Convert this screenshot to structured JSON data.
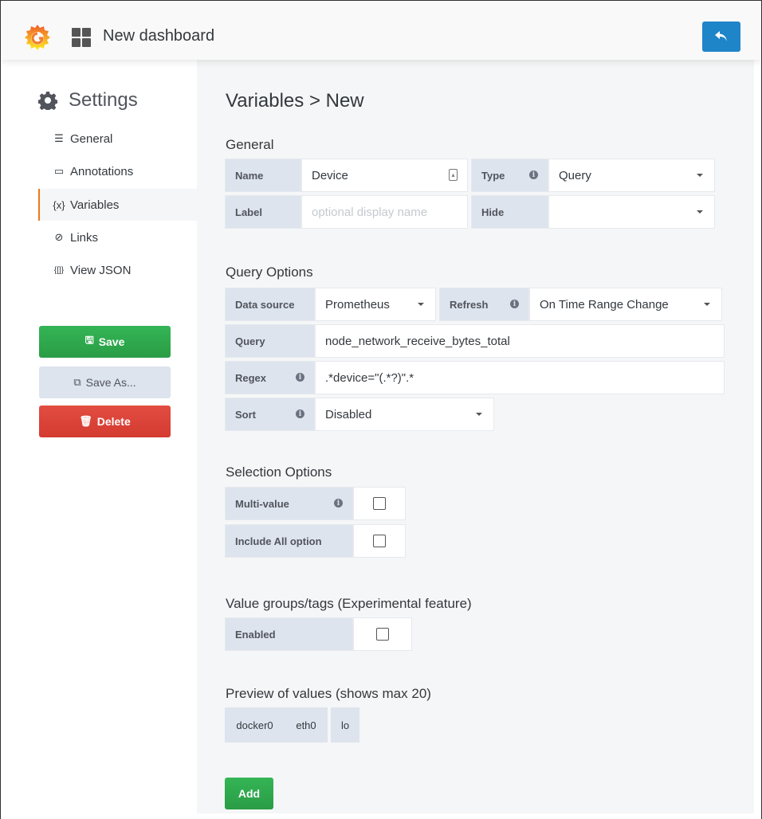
{
  "header": {
    "dashboard_title": "New dashboard"
  },
  "sidebar": {
    "title": "Settings",
    "items": [
      {
        "label": "General",
        "icon": "sliders-icon",
        "glyph": "☰"
      },
      {
        "label": "Annotations",
        "icon": "comment-icon",
        "glyph": "▭"
      },
      {
        "label": "Variables",
        "icon": "variable-icon",
        "glyph": "{x}"
      },
      {
        "label": "Links",
        "icon": "link-icon",
        "glyph": "⊘"
      },
      {
        "label": "View JSON",
        "icon": "json-icon",
        "glyph": "{[]}"
      }
    ],
    "active_item": "Variables",
    "save_label": "Save",
    "save_as_label": "Save As...",
    "delete_label": "Delete"
  },
  "main": {
    "title": "Variables > New",
    "general": {
      "heading": "General",
      "name_label": "Name",
      "name_value": "Device",
      "type_label": "Type",
      "type_value": "Query",
      "label_label": "Label",
      "label_placeholder": "optional display name",
      "hide_label": "Hide",
      "hide_value": ""
    },
    "query_options": {
      "heading": "Query Options",
      "datasource_label": "Data source",
      "datasource_value": "Prometheus",
      "refresh_label": "Refresh",
      "refresh_value": "On Time Range Change",
      "query_label": "Query",
      "query_value": "node_network_receive_bytes_total",
      "regex_label": "Regex",
      "regex_value": ".*device=\"(.*?)\".*",
      "sort_label": "Sort",
      "sort_value": "Disabled"
    },
    "selection_options": {
      "heading": "Selection Options",
      "multi_value_label": "Multi-value",
      "multi_value_checked": false,
      "include_all_label": "Include All option",
      "include_all_checked": false
    },
    "value_groups": {
      "heading": "Value groups/tags (Experimental feature)",
      "enabled_label": "Enabled",
      "enabled_checked": false
    },
    "preview": {
      "heading": "Preview of values (shows max 20)",
      "values": [
        "docker0",
        "eth0",
        "lo"
      ]
    },
    "add_label": "Add"
  },
  "colors": {
    "accent_orange": "#eb7b18",
    "primary_blue": "#1f85c9",
    "success_green": "#2a9c45",
    "danger_red": "#d43a30",
    "label_bg": "#dde4ed"
  }
}
